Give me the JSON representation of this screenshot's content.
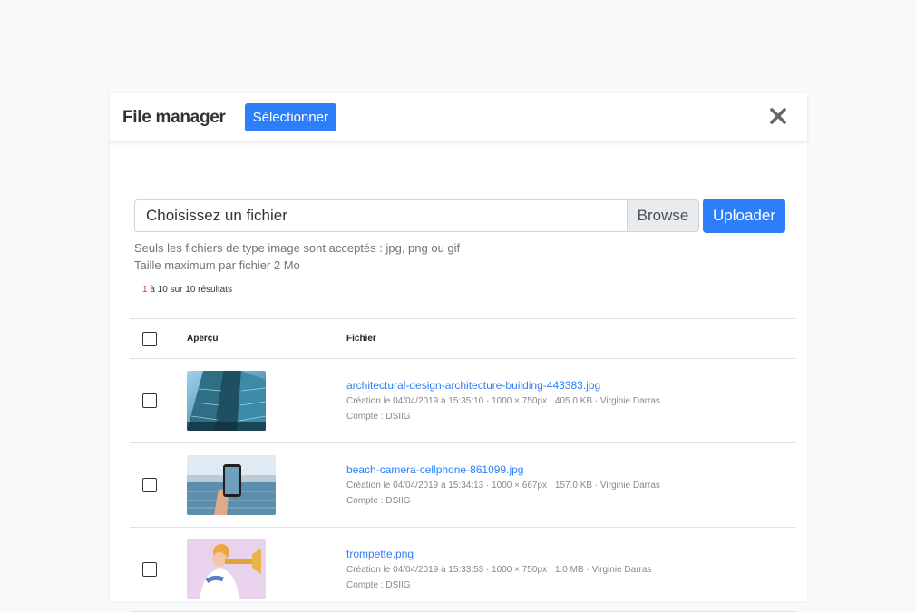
{
  "header": {
    "title": "File manager",
    "select_label": "Sélectionner"
  },
  "upload": {
    "file_placeholder": "Choisissez un fichier",
    "browse_label": "Browse",
    "upload_label": "Uploader",
    "help_line1": "Seuls les fichiers de type image sont acceptés : jpg, png ou gif",
    "help_line2": "Taille maximum par fichier 2 Mo"
  },
  "results": {
    "start": "1",
    "text": " à 10 sur 10 résultats"
  },
  "table": {
    "col_preview": "Aperçu",
    "col_file": "Fichier",
    "rows": [
      {
        "filename": "architectural-design-architecture-building-443383.jpg",
        "meta": "Création le 04/04/2019 à 15:35:10 · 1000 × 750px · 405.0 KB · Virginie Darras",
        "account": "Compte : DSIIG"
      },
      {
        "filename": "beach-camera-cellphone-861099.jpg",
        "meta": "Création le 04/04/2019 à 15:34:13 · 1000 × 667px · 157.0 KB · Virginie Darras",
        "account": "Compte : DSIIG"
      },
      {
        "filename": "trompette.png",
        "meta": "Création le 04/04/2019 à 15:33:53 · 1000 × 750px · 1.0 MB · Virginie Darras",
        "account": "Compte : DSIIG"
      }
    ]
  },
  "colors": {
    "primary": "#2d7ff9",
    "results_number": "#c0392b"
  }
}
